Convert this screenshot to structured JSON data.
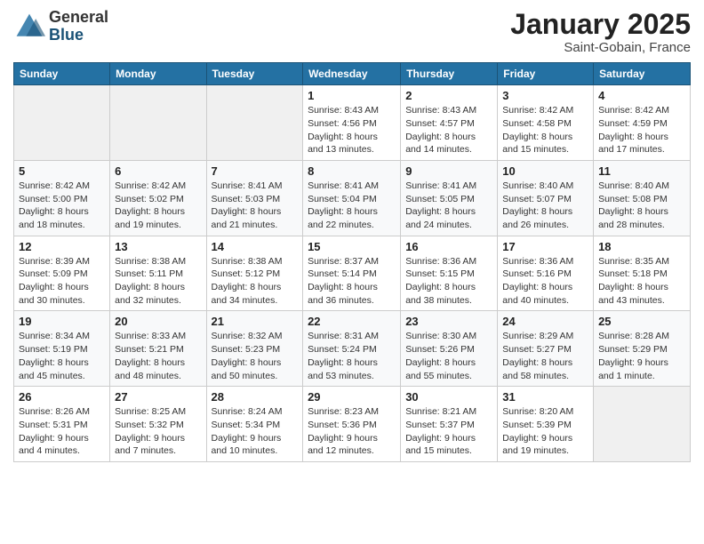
{
  "logo": {
    "general": "General",
    "blue": "Blue"
  },
  "title": "January 2025",
  "location": "Saint-Gobain, France",
  "days_header": [
    "Sunday",
    "Monday",
    "Tuesday",
    "Wednesday",
    "Thursday",
    "Friday",
    "Saturday"
  ],
  "weeks": [
    [
      {
        "day": "",
        "info": ""
      },
      {
        "day": "",
        "info": ""
      },
      {
        "day": "",
        "info": ""
      },
      {
        "day": "1",
        "info": "Sunrise: 8:43 AM\nSunset: 4:56 PM\nDaylight: 8 hours\nand 13 minutes."
      },
      {
        "day": "2",
        "info": "Sunrise: 8:43 AM\nSunset: 4:57 PM\nDaylight: 8 hours\nand 14 minutes."
      },
      {
        "day": "3",
        "info": "Sunrise: 8:42 AM\nSunset: 4:58 PM\nDaylight: 8 hours\nand 15 minutes."
      },
      {
        "day": "4",
        "info": "Sunrise: 8:42 AM\nSunset: 4:59 PM\nDaylight: 8 hours\nand 17 minutes."
      }
    ],
    [
      {
        "day": "5",
        "info": "Sunrise: 8:42 AM\nSunset: 5:00 PM\nDaylight: 8 hours\nand 18 minutes."
      },
      {
        "day": "6",
        "info": "Sunrise: 8:42 AM\nSunset: 5:02 PM\nDaylight: 8 hours\nand 19 minutes."
      },
      {
        "day": "7",
        "info": "Sunrise: 8:41 AM\nSunset: 5:03 PM\nDaylight: 8 hours\nand 21 minutes."
      },
      {
        "day": "8",
        "info": "Sunrise: 8:41 AM\nSunset: 5:04 PM\nDaylight: 8 hours\nand 22 minutes."
      },
      {
        "day": "9",
        "info": "Sunrise: 8:41 AM\nSunset: 5:05 PM\nDaylight: 8 hours\nand 24 minutes."
      },
      {
        "day": "10",
        "info": "Sunrise: 8:40 AM\nSunset: 5:07 PM\nDaylight: 8 hours\nand 26 minutes."
      },
      {
        "day": "11",
        "info": "Sunrise: 8:40 AM\nSunset: 5:08 PM\nDaylight: 8 hours\nand 28 minutes."
      }
    ],
    [
      {
        "day": "12",
        "info": "Sunrise: 8:39 AM\nSunset: 5:09 PM\nDaylight: 8 hours\nand 30 minutes."
      },
      {
        "day": "13",
        "info": "Sunrise: 8:38 AM\nSunset: 5:11 PM\nDaylight: 8 hours\nand 32 minutes."
      },
      {
        "day": "14",
        "info": "Sunrise: 8:38 AM\nSunset: 5:12 PM\nDaylight: 8 hours\nand 34 minutes."
      },
      {
        "day": "15",
        "info": "Sunrise: 8:37 AM\nSunset: 5:14 PM\nDaylight: 8 hours\nand 36 minutes."
      },
      {
        "day": "16",
        "info": "Sunrise: 8:36 AM\nSunset: 5:15 PM\nDaylight: 8 hours\nand 38 minutes."
      },
      {
        "day": "17",
        "info": "Sunrise: 8:36 AM\nSunset: 5:16 PM\nDaylight: 8 hours\nand 40 minutes."
      },
      {
        "day": "18",
        "info": "Sunrise: 8:35 AM\nSunset: 5:18 PM\nDaylight: 8 hours\nand 43 minutes."
      }
    ],
    [
      {
        "day": "19",
        "info": "Sunrise: 8:34 AM\nSunset: 5:19 PM\nDaylight: 8 hours\nand 45 minutes."
      },
      {
        "day": "20",
        "info": "Sunrise: 8:33 AM\nSunset: 5:21 PM\nDaylight: 8 hours\nand 48 minutes."
      },
      {
        "day": "21",
        "info": "Sunrise: 8:32 AM\nSunset: 5:23 PM\nDaylight: 8 hours\nand 50 minutes."
      },
      {
        "day": "22",
        "info": "Sunrise: 8:31 AM\nSunset: 5:24 PM\nDaylight: 8 hours\nand 53 minutes."
      },
      {
        "day": "23",
        "info": "Sunrise: 8:30 AM\nSunset: 5:26 PM\nDaylight: 8 hours\nand 55 minutes."
      },
      {
        "day": "24",
        "info": "Sunrise: 8:29 AM\nSunset: 5:27 PM\nDaylight: 8 hours\nand 58 minutes."
      },
      {
        "day": "25",
        "info": "Sunrise: 8:28 AM\nSunset: 5:29 PM\nDaylight: 9 hours\nand 1 minute."
      }
    ],
    [
      {
        "day": "26",
        "info": "Sunrise: 8:26 AM\nSunset: 5:31 PM\nDaylight: 9 hours\nand 4 minutes."
      },
      {
        "day": "27",
        "info": "Sunrise: 8:25 AM\nSunset: 5:32 PM\nDaylight: 9 hours\nand 7 minutes."
      },
      {
        "day": "28",
        "info": "Sunrise: 8:24 AM\nSunset: 5:34 PM\nDaylight: 9 hours\nand 10 minutes."
      },
      {
        "day": "29",
        "info": "Sunrise: 8:23 AM\nSunset: 5:36 PM\nDaylight: 9 hours\nand 12 minutes."
      },
      {
        "day": "30",
        "info": "Sunrise: 8:21 AM\nSunset: 5:37 PM\nDaylight: 9 hours\nand 15 minutes."
      },
      {
        "day": "31",
        "info": "Sunrise: 8:20 AM\nSunset: 5:39 PM\nDaylight: 9 hours\nand 19 minutes."
      },
      {
        "day": "",
        "info": ""
      }
    ]
  ]
}
